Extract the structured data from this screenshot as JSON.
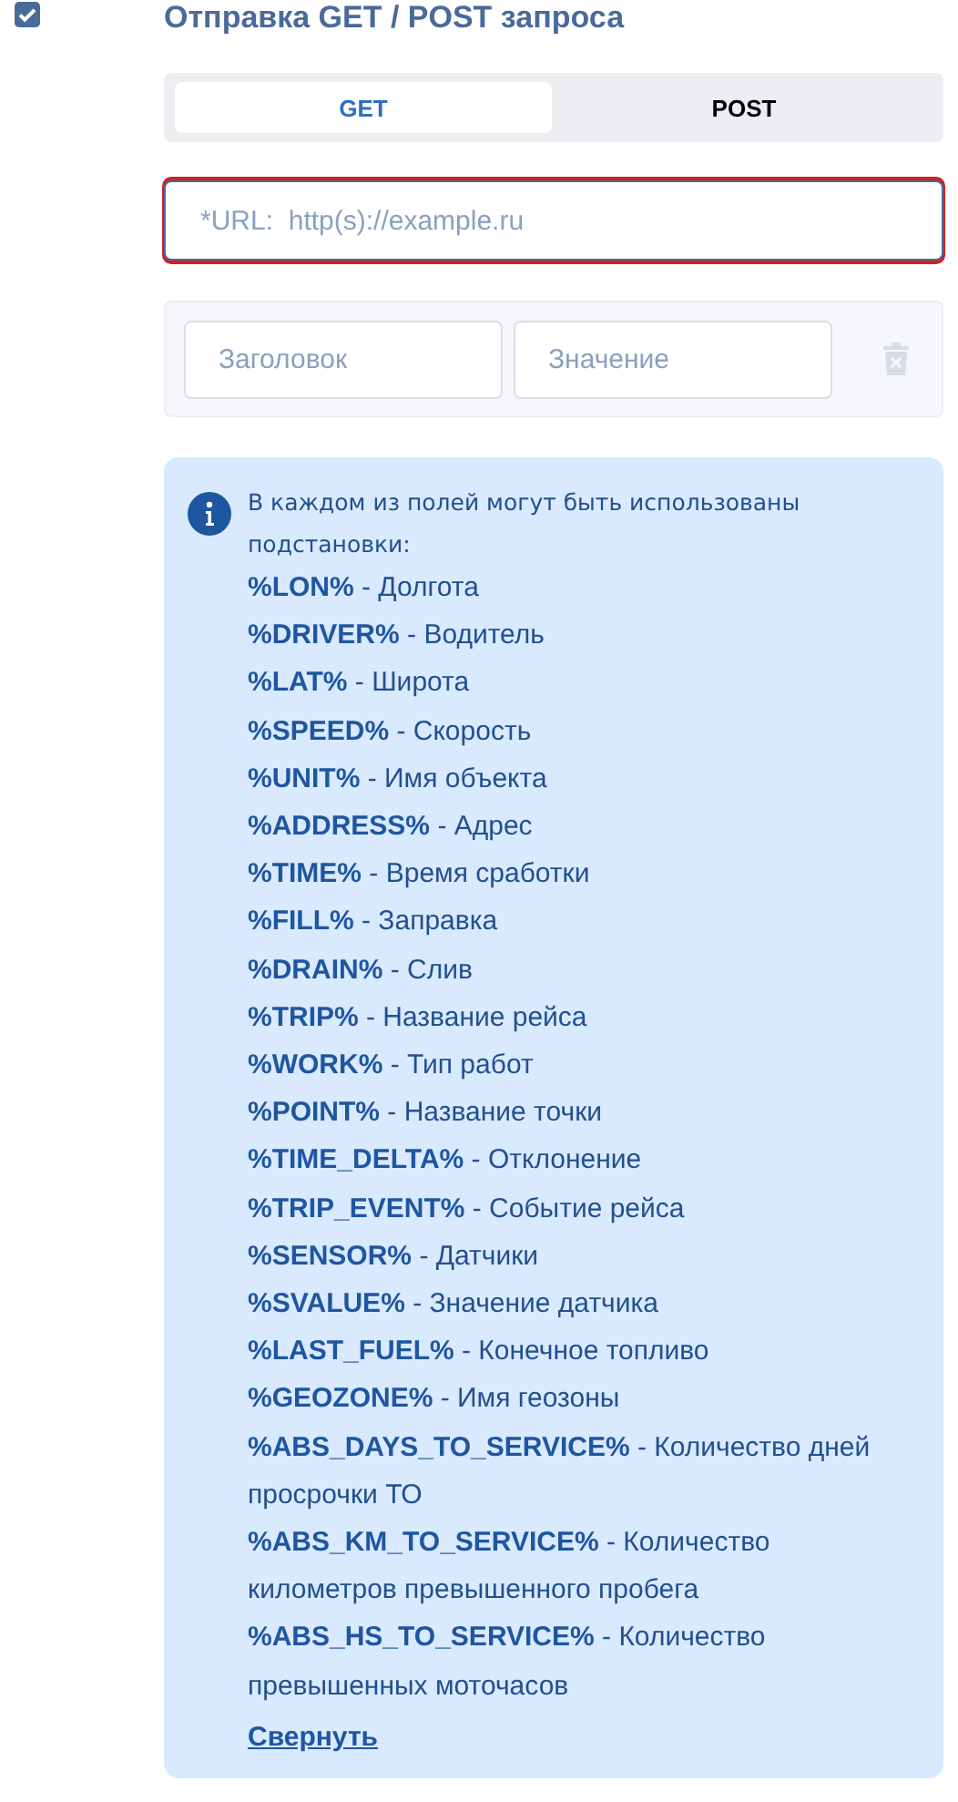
{
  "section": {
    "checked": true,
    "title": "Отправка GET / POST запроса"
  },
  "method_tabs": [
    {
      "label": "GET",
      "selected": true
    },
    {
      "label": "POST",
      "selected": false
    }
  ],
  "url_field": {
    "placeholder": "*URL:  http(s)://example.ru",
    "invalid": true
  },
  "header_row": {
    "name_placeholder": "Заголовок",
    "value_placeholder": "Значение",
    "delete_disabled": true
  },
  "info": {
    "intro": "В каждом из полей могут быть использованы подстановки:",
    "items": [
      "**%LON%** - Долгота",
      "**%DRIVER%** - Водитель",
      "**%LAT%** - Широта",
      "**%SPEED%** - Скорость",
      "**%UNIT%** - Имя объекта",
      "**%ADDRESS%** - Адрес",
      "**%TIME%** - Время сработки",
      "**%FILL%** - Заправка",
      "**%DRAIN%** - Слив",
      "**%TRIP%** - Название рейса",
      "**%WORK%** - Тип работ",
      "**%POINT%** - Название точки",
      "**%TIME_DELTA%** - Отклонение",
      "**%TRIP_EVENT%** - Событие рейса",
      "**%SENSOR%** - Датчики",
      "**%SVALUE%** - Значение датчика",
      "**%LAST_FUEL%** - Конечное топливо",
      "**%GEOZONE%** - Имя геозоны",
      "**%ABS_DAYS_TO_SERVICE%** - Количество дней просрочки ТО",
      "**%ABS_KM_TO_SERVICE%** - Количество километров превышенного пробега",
      "**%ABS_HS_TO_SERVICE%** - Количество превышенных моточасов"
    ],
    "collapse_link": "Свернуть"
  }
}
